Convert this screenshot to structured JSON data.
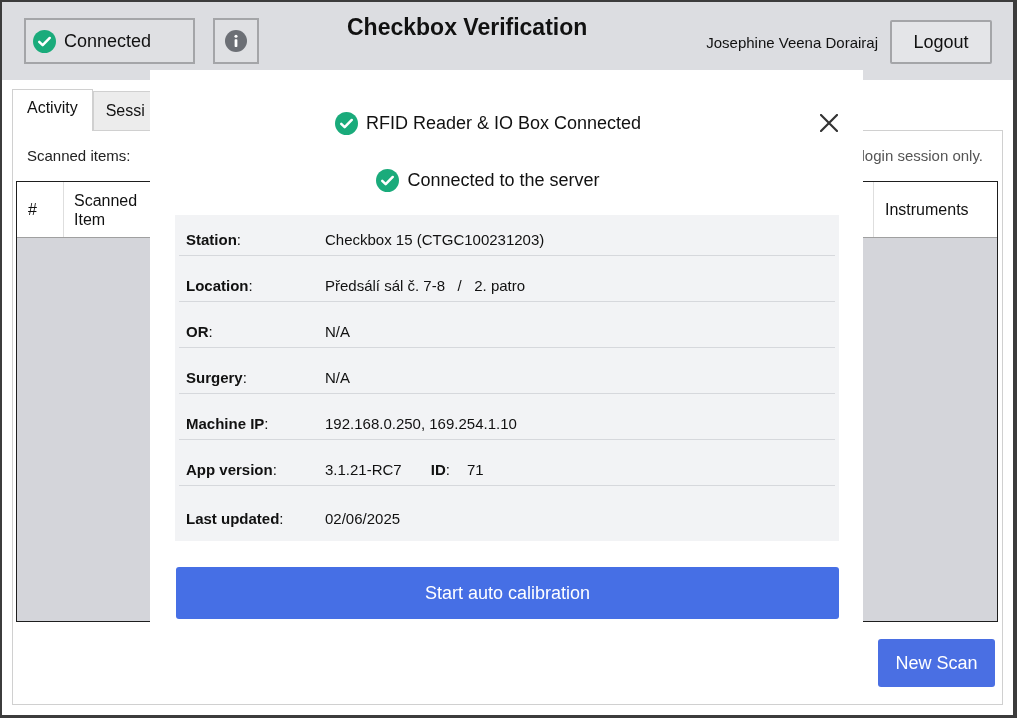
{
  "header": {
    "connection": {
      "label": "Connected",
      "connected": true
    },
    "title": "Checkbox Verification",
    "user": "Josephine Veena Dorairaj",
    "logout": "Logout"
  },
  "tabs": [
    {
      "label": "Activity",
      "selected": true
    },
    {
      "label": "Sessi",
      "selected": false
    }
  ],
  "activity": {
    "scanned_items_label": "Scanned items:",
    "note": "login session only.",
    "table": {
      "columns": [
        "#",
        "Scanned Item",
        "Instruments"
      ]
    },
    "new_scan": "New Scan"
  },
  "dialog": {
    "statuses": [
      {
        "label": "RFID Reader & IO Box Connected",
        "ok": true
      },
      {
        "label": "Connected to the server",
        "ok": true
      }
    ],
    "details": [
      {
        "label": "**Station**:",
        "value": "Checkbox 15 (CTGC100231203)"
      },
      {
        "label": "**Location**:",
        "value": "Předsálí sál č. 7-8   /   2. patro"
      },
      {
        "label": "**OR**:",
        "value": "N/A"
      },
      {
        "label": "**Surgery**:",
        "value": "N/A"
      },
      {
        "label": "**Machine IP**:",
        "value": "192.168.0.250, 169.254.1.10"
      },
      {
        "label": "**App version**:",
        "value": "3.1.21-RC7",
        "extra_label": "**ID**:",
        "extra_value": "71"
      },
      {
        "label": "**Last updated**:",
        "value": "02/06/2025"
      }
    ],
    "button": "Start auto calibration"
  }
}
